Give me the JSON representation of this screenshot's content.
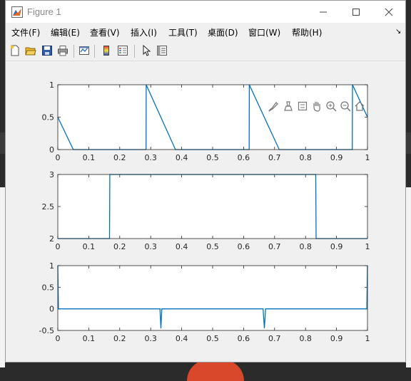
{
  "window": {
    "title": "Figure 1"
  },
  "menu": [
    {
      "label": "文件(F)"
    },
    {
      "label": "编辑(E)"
    },
    {
      "label": "查看(V)"
    },
    {
      "label": "插入(I)"
    },
    {
      "label": "工具(T)"
    },
    {
      "label": "桌面(D)"
    },
    {
      "label": "窗口(W)"
    },
    {
      "label": "帮助(H)"
    }
  ],
  "toolbar": [
    "new-figure-icon",
    "open-file-icon",
    "save-icon",
    "print-icon",
    "link-plot-icon",
    "insert-colorbar-icon",
    "insert-legend-icon",
    "edit-plot-cursor-icon",
    "property-inspector-icon"
  ],
  "axes_toolbar": [
    "brush-icon",
    "data-tips-icon",
    "restore-view-icon",
    "pan-icon",
    "zoom-in-icon",
    "zoom-out-icon",
    "home-icon"
  ],
  "chart_data": [
    {
      "type": "line",
      "xlim": [
        0,
        1
      ],
      "ylim": [
        0,
        1
      ],
      "xticks": [
        "0",
        "0.1",
        "0.2",
        "0.3",
        "0.4",
        "0.5",
        "0.6",
        "0.7",
        "0.8",
        "0.9",
        "1"
      ],
      "yticks": [
        "0",
        "0.5",
        "1"
      ],
      "series": [
        {
          "x": [
            0,
            0.05,
            0.285,
            0.2855,
            0.38,
            0.618,
            0.6185,
            0.715,
            0.951,
            0.9515,
            1
          ],
          "y": [
            0.5,
            0,
            0,
            1,
            0,
            0,
            1,
            0,
            0,
            1,
            0.5
          ]
        }
      ]
    },
    {
      "type": "line",
      "xlim": [
        0,
        1
      ],
      "ylim": [
        2,
        3
      ],
      "xticks": [
        "0",
        "0.1",
        "0.2",
        "0.3",
        "0.4",
        "0.5",
        "0.6",
        "0.7",
        "0.8",
        "0.9",
        "1"
      ],
      "yticks": [
        "2",
        "2.5",
        "3"
      ],
      "series": [
        {
          "x": [
            0,
            0.167,
            0.168,
            0.833,
            0.834,
            1
          ],
          "y": [
            2,
            2,
            3,
            3,
            2,
            2
          ]
        }
      ]
    },
    {
      "type": "line",
      "xlim": [
        0,
        1
      ],
      "ylim": [
        -0.5,
        1
      ],
      "xticks": [
        "0",
        "0.1",
        "0.2",
        "0.3",
        "0.4",
        "0.5",
        "0.6",
        "0.7",
        "0.8",
        "0.9",
        "1"
      ],
      "yticks": [
        "-0.5",
        "0",
        "0.5",
        "1"
      ],
      "series": [
        {
          "x": [
            0,
            0.002,
            0.004,
            0.33,
            0.333,
            0.336,
            0.663,
            0.667,
            0.671,
            0.996,
            0.998,
            1
          ],
          "y": [
            1,
            0,
            0,
            0,
            -0.45,
            0,
            0,
            -0.45,
            0,
            0,
            0,
            1
          ]
        }
      ]
    }
  ]
}
